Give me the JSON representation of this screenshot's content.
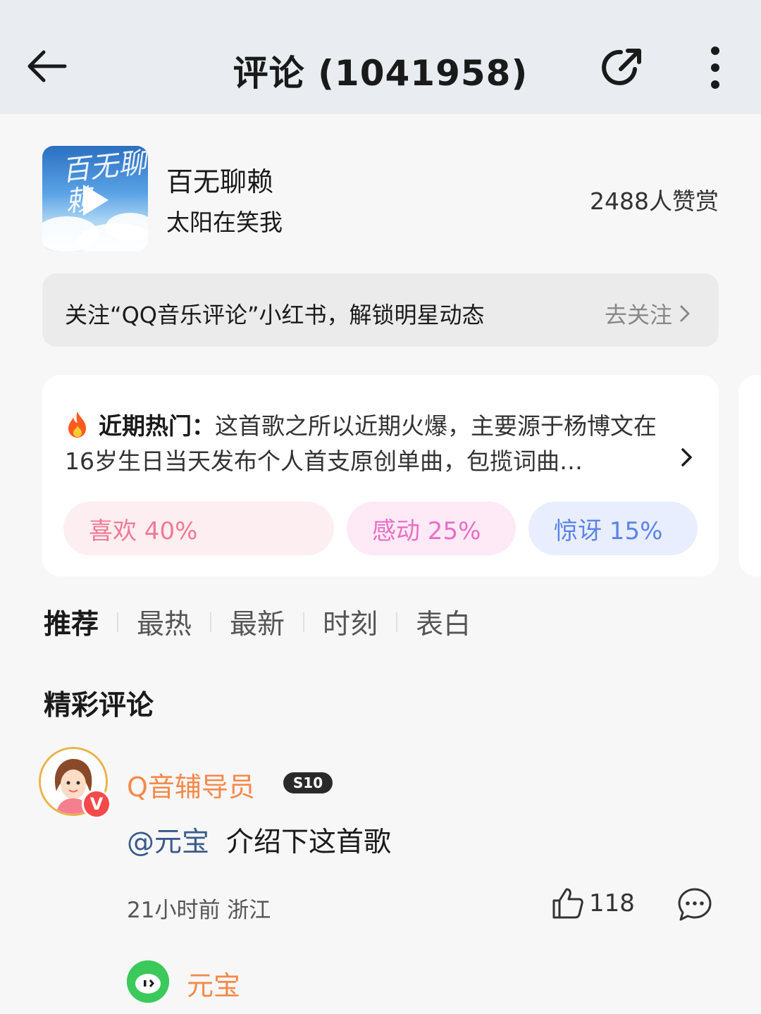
{
  "header": {
    "title": "评论 (1041958)",
    "back_icon": "arrow-left-icon",
    "share_icon": "share-icon",
    "more_icon": "more-vertical-icon"
  },
  "song": {
    "cover_text": "百无聊赖",
    "name": "百无聊赖",
    "artist": "太阳在笑我",
    "reward_count": "2488人赞赏"
  },
  "banner": {
    "text": "关注“QQ音乐评论”小红书，解锁明星动态",
    "link": "去关注"
  },
  "hot": {
    "label": "近期热门：",
    "text": "这首歌之所以近期火爆，主要源于杨博文在16岁生日当天发布个人首支原创单曲，包揽词曲…",
    "chips": [
      {
        "label": "喜欢 40%"
      },
      {
        "label": "感动 25%"
      },
      {
        "label": "惊讶 15%"
      }
    ]
  },
  "tabs": [
    "推荐",
    "最热",
    "最新",
    "时刻",
    "表白"
  ],
  "section_title": "精彩评论",
  "comment": {
    "username": "Q音辅导员",
    "level": "S10",
    "verified": "V",
    "mention": "@元宝",
    "text": "介绍下这首歌",
    "meta": "21小时前 浙江",
    "likes": "118"
  },
  "reply": {
    "username": "元宝"
  },
  "colors": {
    "accent_orange": "#f5894a",
    "mention_blue": "#3a5b8c"
  }
}
